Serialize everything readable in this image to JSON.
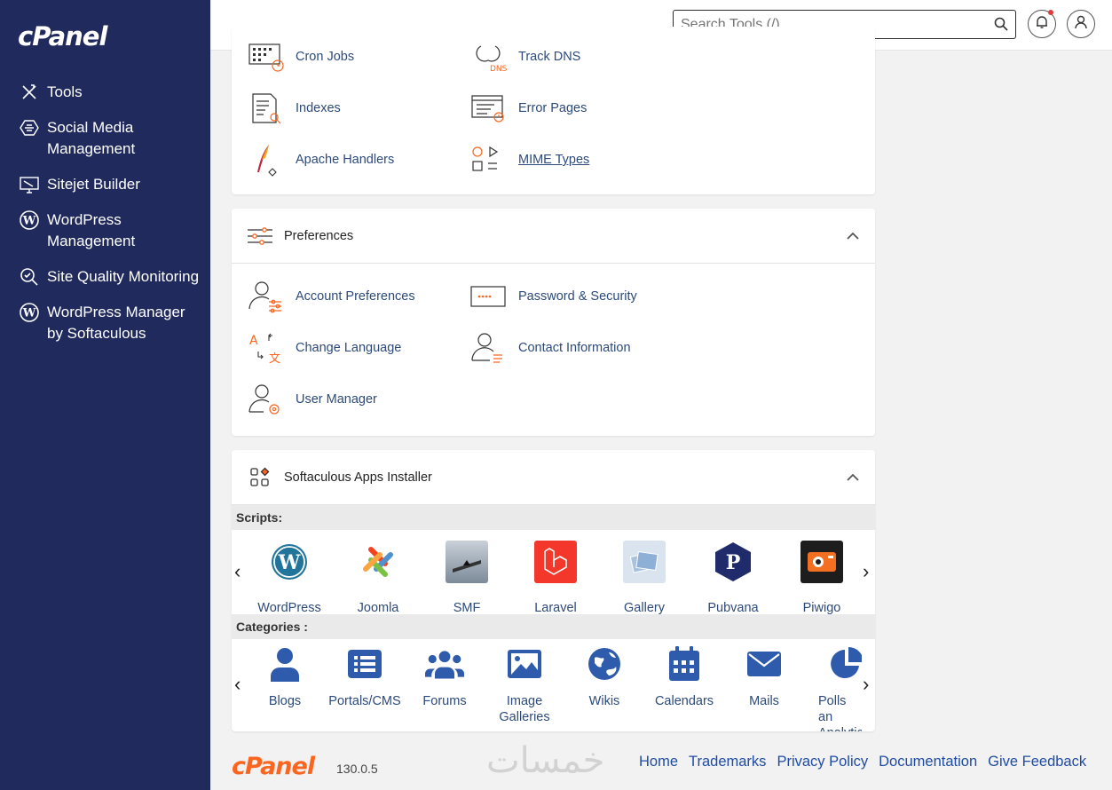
{
  "sidebar": {
    "logo": "cPanel",
    "items": [
      {
        "label": "Tools"
      },
      {
        "label": "Social Media Management"
      },
      {
        "label": "Sitejet Builder"
      },
      {
        "label": "WordPress Management"
      },
      {
        "label": "Site Quality Monitoring"
      },
      {
        "label": "WordPress Manager by Softaculous"
      }
    ]
  },
  "header": {
    "search_placeholder": "Search Tools (/)"
  },
  "advanced": {
    "items": [
      "Cron Jobs",
      "Track DNS",
      "Indexes",
      "Error Pages",
      "Apache Handlers",
      "MIME Types"
    ]
  },
  "preferences": {
    "title": "Preferences",
    "items": [
      "Account Preferences",
      "Password & Security",
      "Change Language",
      "Contact Information",
      "User Manager"
    ]
  },
  "softaculous": {
    "title": "Softaculous Apps Installer",
    "scripts_label": "Scripts:",
    "scripts": [
      "WordPress",
      "Joomla",
      "SMF",
      "Laravel",
      "Gallery",
      "Pubvana",
      "Piwigo"
    ],
    "categories_label": "Categories :",
    "categories": [
      "Blogs",
      "Portals/CMS",
      "Forums",
      "Image Galleries",
      "Wikis",
      "Calendars",
      "Mails",
      "Polls an Analytic"
    ]
  },
  "footer": {
    "logo": "cPanel",
    "version": "130.0.5",
    "watermark": "خمسات",
    "links": [
      "Home",
      "Trademarks",
      "Privacy Policy",
      "Documentation",
      "Give Feedback"
    ]
  },
  "colors": {
    "sidebar_bg": "#202a5c",
    "accent_orange": "#fa6620",
    "link_blue": "#2d4a7a",
    "category_blue": "#2e5bab"
  }
}
